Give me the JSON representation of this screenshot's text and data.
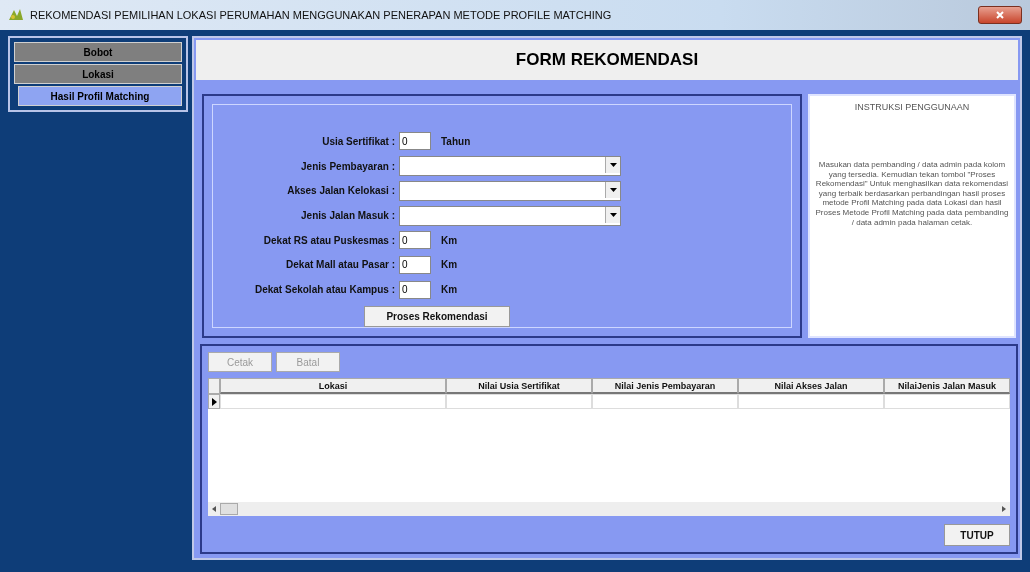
{
  "window": {
    "title": "REKOMENDASI PEMILIHAN LOKASI PERUMAHAN MENGGUNAKAN PENERAPAN METODE PROFILE MATCHING"
  },
  "sidebar": {
    "items": [
      {
        "label": "Bobot",
        "selected": false
      },
      {
        "label": "Lokasi",
        "selected": false
      },
      {
        "label": "Hasil Profil Matching",
        "selected": true
      }
    ]
  },
  "header": "FORM REKOMENDASI",
  "form": {
    "fields": [
      {
        "kind": "text",
        "label": "Usia Sertifikat :",
        "value": "0",
        "unit": "Tahun"
      },
      {
        "kind": "combo",
        "label": "Jenis Pembayaran :"
      },
      {
        "kind": "combo",
        "label": "Akses Jalan Kelokasi :"
      },
      {
        "kind": "combo",
        "label": "Jenis Jalan Masuk :"
      },
      {
        "kind": "text",
        "label": "Dekat RS atau Puskesmas :",
        "value": "0",
        "unit": "Km"
      },
      {
        "kind": "text",
        "label": "Dekat Mall atau Pasar :",
        "value": "0",
        "unit": "Km"
      },
      {
        "kind": "text",
        "label": "Dekat Sekolah atau Kampus :",
        "value": "0",
        "unit": "Km"
      }
    ],
    "submit": "Proses Rekomendasi"
  },
  "instructions": {
    "title": "INSTRUKSI PENGGUNAAN",
    "text": "Masukan data pembanding / data admin pada kolom yang tersedia. Kemudian tekan tombol \"Proses Rekomendasi\" Untuk menghasilkan data rekomendasi yang terbaik berdasarkan perbandingan hasil proses metode Profil Matching pada data Lokasi dan hasil Proses Metode Profil Matching pada data pembanding / data admin pada halaman cetak."
  },
  "actions": [
    {
      "label": "Cetak",
      "disabled": true
    },
    {
      "label": "Batal",
      "disabled": true
    }
  ],
  "table": {
    "columns": [
      "Lokasi",
      "Nilai Usia Sertifikat",
      "Nilai Jenis Pembayaran",
      "Nilai Akses Jalan",
      "NilaiJenis Jalan Masuk"
    ]
  },
  "close_button": "TUTUP"
}
